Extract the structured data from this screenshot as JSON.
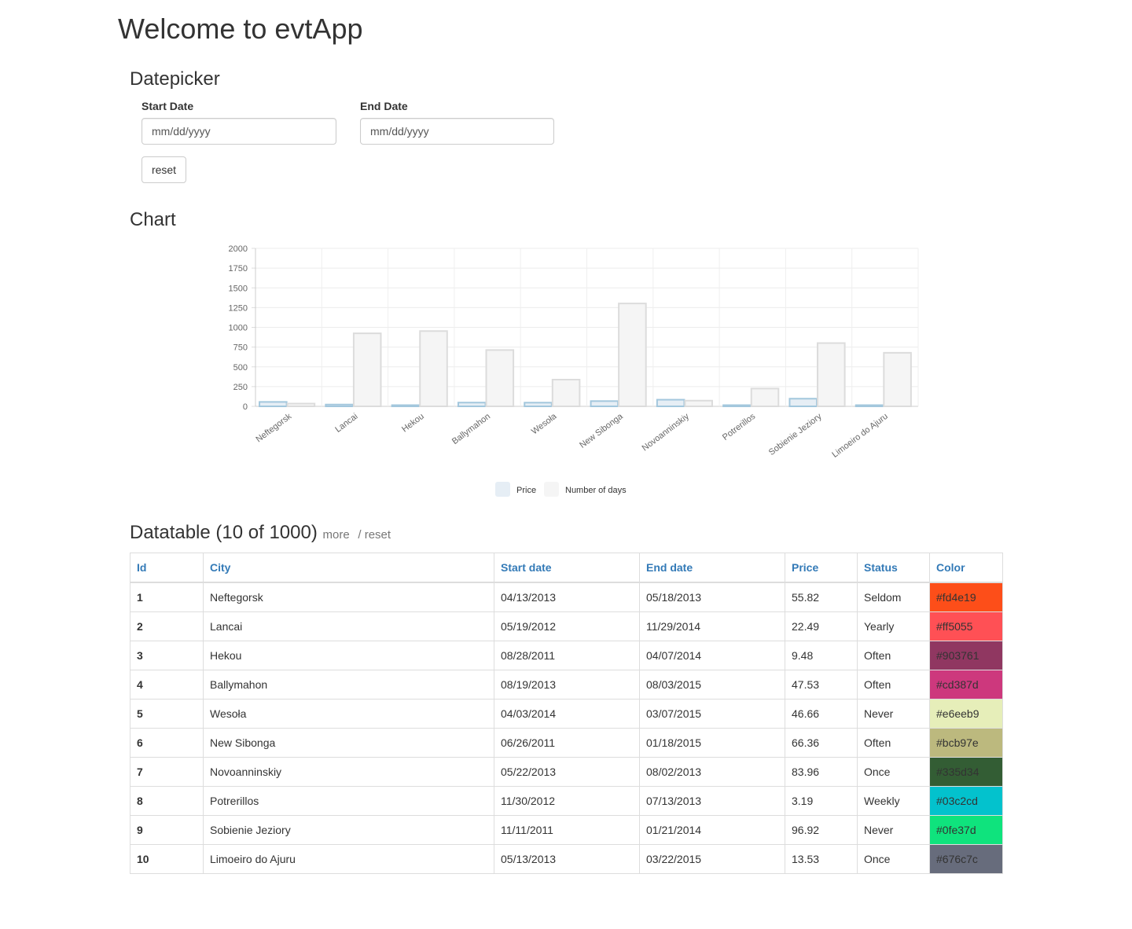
{
  "app": {
    "title": "Welcome to evtApp"
  },
  "datepicker": {
    "title": "Datepicker",
    "start": {
      "label": "Start Date",
      "placeholder": "mm/dd/yyyy"
    },
    "end": {
      "label": "End Date",
      "placeholder": "mm/dd/yyyy"
    },
    "reset_label": "reset"
  },
  "chart_section": {
    "title": "Chart"
  },
  "chart_data": {
    "type": "bar",
    "categories": [
      "Neftegorsk",
      "Lancai",
      "Hekou",
      "Ballymahon",
      "Wesoła",
      "New Sibonga",
      "Novoanninskiy",
      "Potrerillos",
      "Sobienie Jeziory",
      "Limoeiro do Ajuru"
    ],
    "series": [
      {
        "name": "Price",
        "values": [
          55.82,
          22.49,
          9.48,
          47.53,
          46.66,
          66.36,
          83.96,
          3.19,
          96.92,
          13.53
        ],
        "fill": "#e6eef5",
        "stroke": "#a3c7dd"
      },
      {
        "name": "Number of days",
        "values": [
          35,
          924,
          953,
          713,
          338,
          1302,
          72,
          225,
          801,
          678
        ],
        "fill": "#f5f5f5",
        "stroke": "#dcdcdc"
      }
    ],
    "yticks": [
      "0",
      "250",
      "500",
      "750",
      "1000",
      "1250",
      "1500",
      "1750",
      "2000"
    ],
    "ylim": [
      0,
      2000
    ],
    "grid": true,
    "legend_position": "bottom"
  },
  "datatable": {
    "title": "Datatable (10 of 1000)",
    "more_label": "more",
    "reset_label": "/ reset",
    "columns": [
      "Id",
      "City",
      "Start date",
      "End date",
      "Price",
      "Status",
      "Color"
    ],
    "rows": [
      [
        "1",
        "Neftegorsk",
        "04/13/2013",
        "05/18/2013",
        "55.82",
        "Seldom",
        "#fd4e19"
      ],
      [
        "2",
        "Lancai",
        "05/19/2012",
        "11/29/2014",
        "22.49",
        "Yearly",
        "#ff5055"
      ],
      [
        "3",
        "Hekou",
        "08/28/2011",
        "04/07/2014",
        "9.48",
        "Often",
        "#903761"
      ],
      [
        "4",
        "Ballymahon",
        "08/19/2013",
        "08/03/2015",
        "47.53",
        "Often",
        "#cd387d"
      ],
      [
        "5",
        "Wesoła",
        "04/03/2014",
        "03/07/2015",
        "46.66",
        "Never",
        "#e6eeb9"
      ],
      [
        "6",
        "New Sibonga",
        "06/26/2011",
        "01/18/2015",
        "66.36",
        "Often",
        "#bcb97e"
      ],
      [
        "7",
        "Novoanninskiy",
        "05/22/2013",
        "08/02/2013",
        "83.96",
        "Once",
        "#335d34"
      ],
      [
        "8",
        "Potrerillos",
        "11/30/2012",
        "07/13/2013",
        "3.19",
        "Weekly",
        "#03c2cd"
      ],
      [
        "9",
        "Sobienie Jeziory",
        "11/11/2011",
        "01/21/2014",
        "96.92",
        "Never",
        "#0fe37d"
      ],
      [
        "10",
        "Limoeiro do Ajuru",
        "05/13/2013",
        "03/22/2015",
        "13.53",
        "Once",
        "#676c7c"
      ]
    ]
  }
}
